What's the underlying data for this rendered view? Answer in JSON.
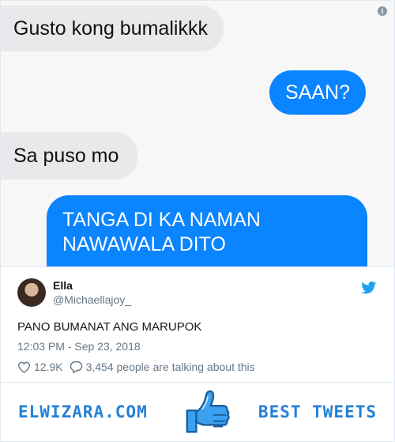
{
  "chat": {
    "messages": [
      {
        "from": "them",
        "text": "Gusto kong bumalikkk"
      },
      {
        "from": "me",
        "text": "SAAN?"
      },
      {
        "from": "them",
        "text": "Sa puso mo"
      },
      {
        "from": "me",
        "line1": "TANGA DI KA NAMAN",
        "line2": "NAWAWALA DITO"
      }
    ],
    "info_icon_glyph": "i"
  },
  "tweet": {
    "name": "Ella",
    "handle": "@Michaellajoy_",
    "text": "PANO BUMANAT ANG MARUPOK",
    "timestamp": "12:03 PM - Sep 23, 2018",
    "likes": "12.9K",
    "talking": "3,454 people are talking about this",
    "icons": [
      "heart-icon",
      "comment-icon",
      "twitter-bird-icon"
    ],
    "brand_color": "#1da1f2"
  },
  "footer": {
    "site": "ELWIZARA.COM",
    "label": "BEST TWEETS",
    "accent": "#2380d6"
  }
}
